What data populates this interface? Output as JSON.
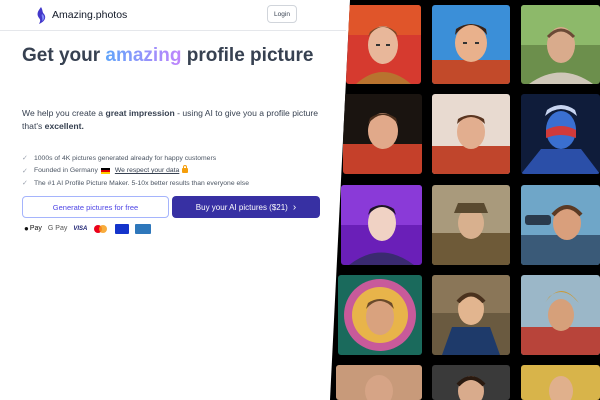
{
  "header": {
    "brand": "Amazing.photos",
    "login_label": "Login",
    "logo_icon": "flame-logo-icon"
  },
  "hero": {
    "title_part1": "Get your ",
    "title_accent": "amazing",
    "title_part2": " profile picture",
    "desc_part1": "We help you create a ",
    "desc_strong1": "great impression",
    "desc_part2": " - using AI to give you a profile picture that's ",
    "desc_strong2": "excellent."
  },
  "features": {
    "f1": "1000s of 4K pictures generated already for happy customers",
    "f2_prefix": "Founded in Germany",
    "f2_link": "We respect your data",
    "f3": "The #1 AI Profile Picture Maker. 5-10x better results than everyone else"
  },
  "cta": {
    "secondary_label": "Generate pictures for free",
    "primary_label": "Buy your AI pictures ($21)"
  },
  "payments": {
    "apple_pay": "Pay",
    "google_pay": "G Pay",
    "visa": "VISA"
  },
  "colors": {
    "accent_primary": "#3730a3",
    "accent_secondary": "#4f46e5",
    "gradient_start": "#60a5fa",
    "gradient_end": "#c084fc",
    "gallery_bg": "#000000"
  }
}
